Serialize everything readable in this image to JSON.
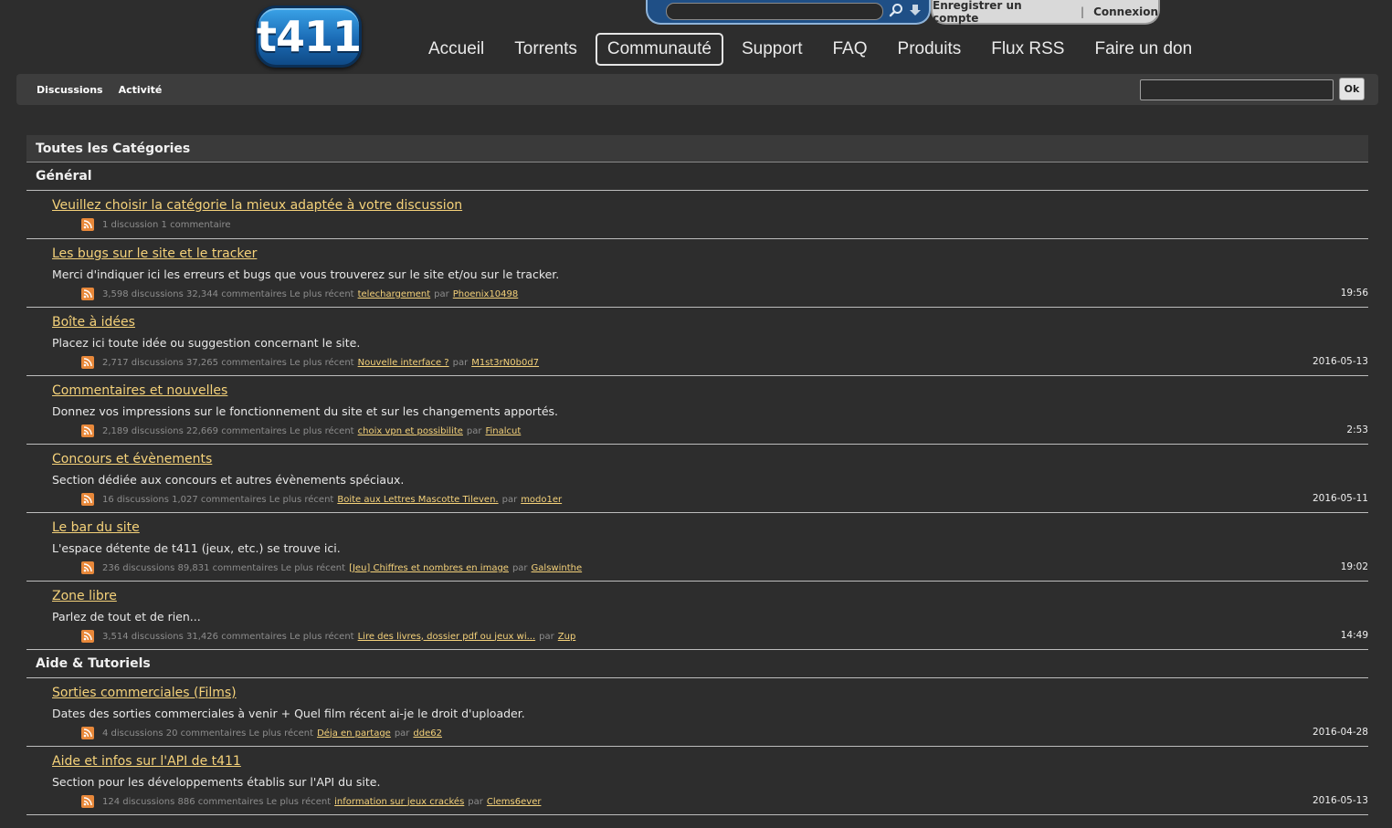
{
  "header": {
    "logo_text": "t411",
    "search_placeholder": "",
    "search_icon": "search-icon",
    "download_icon": "arrow-down-icon",
    "account": {
      "register": "Enregistrer un compte",
      "separator": "|",
      "login": "Connexion"
    },
    "nav": [
      "Accueil",
      "Torrents",
      "Communauté",
      "Support",
      "FAQ",
      "Produits",
      "Flux RSS",
      "Faire un don"
    ],
    "active_nav": "Communauté"
  },
  "subnav": {
    "links": [
      "Discussions",
      "Activité"
    ],
    "search_placeholder": "",
    "ok_label": "Ok"
  },
  "content": {
    "all_categories": "Toutes les Catégories",
    "groups": [
      {
        "name": "Général",
        "categories": [
          {
            "title": "Veuillez choisir la catégorie la mieux adaptée à votre discussion",
            "description": "",
            "stats": "1 discussion 1 commentaire",
            "recent_prefix": "",
            "recent_link": "",
            "by": "",
            "author": "",
            "date": ""
          },
          {
            "title": "Les bugs sur le site et le tracker",
            "description": "Merci d'indiquer ici les erreurs et bugs que vous trouverez sur le site et/ou sur le tracker.",
            "stats": "3,598 discussions 32,344 commentaires",
            "recent_prefix": "Le plus récent",
            "recent_link": "telechargement",
            "by": "par",
            "author": "Phoenix10498",
            "date": "19:56"
          },
          {
            "title": "Boîte à idées",
            "description": "Placez ici toute idée ou suggestion concernant le site.",
            "stats": "2,717 discussions 37,265 commentaires",
            "recent_prefix": "Le plus récent",
            "recent_link": "Nouvelle interface ?",
            "by": "par",
            "author": "M1st3rN0b0d7",
            "date": "2016-05-13"
          },
          {
            "title": "Commentaires et nouvelles",
            "description": "Donnez vos impressions sur le fonctionnement du site et sur les changements apportés.",
            "stats": "2,189 discussions 22,669 commentaires",
            "recent_prefix": "Le plus récent",
            "recent_link": "choix vpn et possibilite",
            "by": "par",
            "author": "Finalcut",
            "date": "2:53"
          },
          {
            "title": "Concours et évènements",
            "description": "Section dédiée aux concours et autres évènements spéciaux.",
            "stats": "16 discussions 1,027 commentaires",
            "recent_prefix": "Le plus récent",
            "recent_link": "Boite aux Lettres Mascotte Tileven.",
            "by": "par",
            "author": "modo1er",
            "date": "2016-05-11"
          },
          {
            "title": "Le bar du site",
            "description": "L'espace détente de t411 (jeux, etc.) se trouve ici.",
            "stats": "236 discussions 89,831 commentaires",
            "recent_prefix": "Le plus récent",
            "recent_link": "[Jeu] Chiffres et nombres en image",
            "by": "par",
            "author": "Galswinthe",
            "date": "19:02"
          },
          {
            "title": "Zone libre",
            "description": "Parlez de tout et de rien...",
            "stats": "3,514 discussions 31,426 commentaires",
            "recent_prefix": "Le plus récent",
            "recent_link": "Lire des livres, dossier pdf ou jeux wi...",
            "by": "par",
            "author": "Zup",
            "date": "14:49"
          }
        ]
      },
      {
        "name": "Aide & Tutoriels",
        "categories": [
          {
            "title": "Sorties commerciales (Films)",
            "description": "Dates des sorties commerciales à venir + Quel film récent ai-je le droit d'uploader.",
            "stats": "4 discussions 20 commentaires",
            "recent_prefix": "Le plus récent",
            "recent_link": "Déja en partage",
            "by": "par",
            "author": "dde62",
            "date": "2016-04-28"
          },
          {
            "title": "Aide et infos sur l'API de t411",
            "description": "Section pour les développements établis sur l'API du site.",
            "stats": "124 discussions 886 commentaires",
            "recent_prefix": "Le plus récent",
            "recent_link": "information sur jeux crackés",
            "by": "par",
            "author": "Clems6ever",
            "date": "2016-05-13"
          }
        ]
      }
    ]
  },
  "colors": {
    "background": "#2d2d2d",
    "link": "#f5d27a",
    "rss": "#e8883a",
    "search_tab": "#1f4f86",
    "account_tab": "#d9d9d9"
  }
}
